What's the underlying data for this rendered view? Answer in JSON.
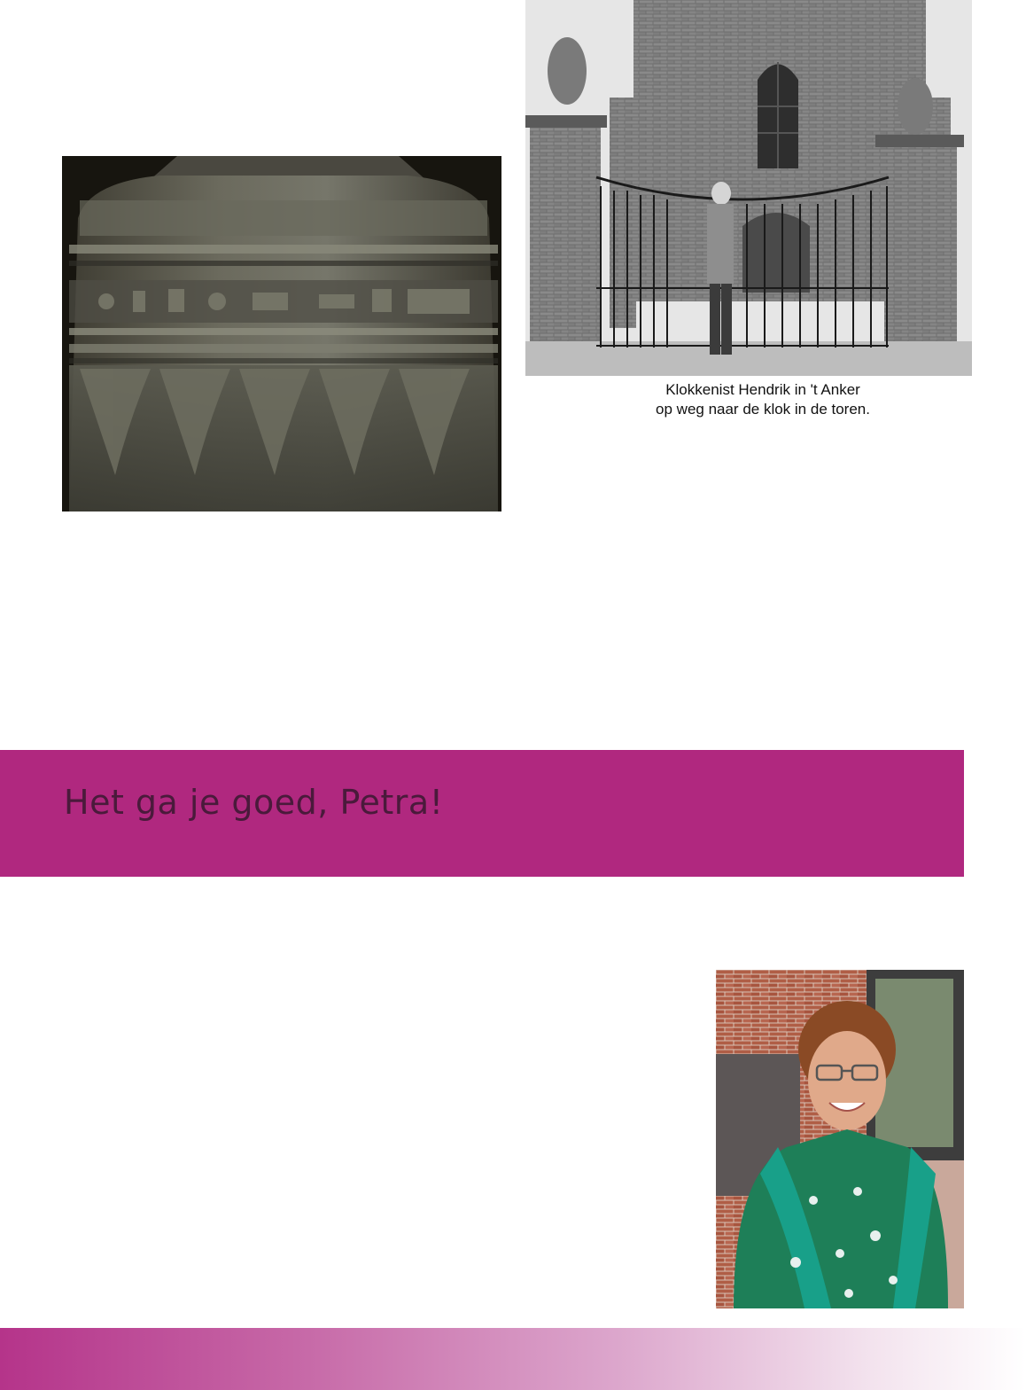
{
  "images": {
    "bell": {
      "icon": "church-bell-photo"
    },
    "church": {
      "icon": "church-gate-photo"
    },
    "portrait": {
      "icon": "woman-portrait-photo"
    }
  },
  "caption": {
    "line1": "Klokkenist Hendrik in 't Anker",
    "line2": "op weg naar de klok in de toren."
  },
  "banner": {
    "title": "Het ga je goed, Petra!",
    "color": "#b0287f",
    "text_color": "#4a1a3b"
  },
  "footer": {
    "gradient_start": "#b5348a",
    "gradient_end": "#ffffff"
  }
}
